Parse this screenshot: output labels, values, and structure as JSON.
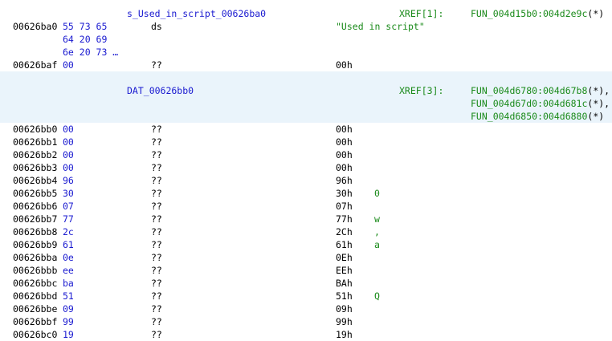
{
  "listing": {
    "string_label": "s_Used_in_script_00626ba0",
    "string_xref_tag": "XREF[1]:",
    "string_xref": {
      "target": "FUN_004d15b0:004d2e9c",
      "marker": "(*)"
    },
    "string_addr": "00626ba0",
    "string_bytes": [
      "55 73 65",
      "64 20 69",
      "6e 20 73 …"
    ],
    "string_mnemonic": "ds",
    "string_value": "\"Used in script\"",
    "term_row": {
      "addr": "00626baf",
      "bytes": "00",
      "mnem": "??",
      "operand": "00h"
    },
    "dat_label": "DAT_00626bb0",
    "dat_xref_tag": "XREF[3]:",
    "dat_xrefs": [
      {
        "target": "FUN_004d6780:004d67b8",
        "marker": "(*),"
      },
      {
        "target": "FUN_004d67d0:004d681c",
        "marker": "(*),"
      },
      {
        "target": "FUN_004d6850:004d6880",
        "marker": "(*)"
      }
    ],
    "rows": [
      {
        "addr": "00626bb0",
        "bytes": "00",
        "mnem": "??",
        "operand": "00h",
        "comment": ""
      },
      {
        "addr": "00626bb1",
        "bytes": "00",
        "mnem": "??",
        "operand": "00h",
        "comment": ""
      },
      {
        "addr": "00626bb2",
        "bytes": "00",
        "mnem": "??",
        "operand": "00h",
        "comment": ""
      },
      {
        "addr": "00626bb3",
        "bytes": "00",
        "mnem": "??",
        "operand": "00h",
        "comment": ""
      },
      {
        "addr": "00626bb4",
        "bytes": "96",
        "mnem": "??",
        "operand": "96h",
        "comment": ""
      },
      {
        "addr": "00626bb5",
        "bytes": "30",
        "mnem": "??",
        "operand": "30h",
        "comment": "0"
      },
      {
        "addr": "00626bb6",
        "bytes": "07",
        "mnem": "??",
        "operand": "07h",
        "comment": ""
      },
      {
        "addr": "00626bb7",
        "bytes": "77",
        "mnem": "??",
        "operand": "77h",
        "comment": "w"
      },
      {
        "addr": "00626bb8",
        "bytes": "2c",
        "mnem": "??",
        "operand": "2Ch",
        "comment": ","
      },
      {
        "addr": "00626bb9",
        "bytes": "61",
        "mnem": "??",
        "operand": "61h",
        "comment": "a"
      },
      {
        "addr": "00626bba",
        "bytes": "0e",
        "mnem": "??",
        "operand": "0Eh",
        "comment": ""
      },
      {
        "addr": "00626bbb",
        "bytes": "ee",
        "mnem": "??",
        "operand": "EEh",
        "comment": ""
      },
      {
        "addr": "00626bbc",
        "bytes": "ba",
        "mnem": "??",
        "operand": "BAh",
        "comment": ""
      },
      {
        "addr": "00626bbd",
        "bytes": "51",
        "mnem": "??",
        "operand": "51h",
        "comment": "Q"
      },
      {
        "addr": "00626bbe",
        "bytes": "09",
        "mnem": "??",
        "operand": "09h",
        "comment": ""
      },
      {
        "addr": "00626bbf",
        "bytes": "99",
        "mnem": "??",
        "operand": "99h",
        "comment": ""
      },
      {
        "addr": "00626bc0",
        "bytes": "19",
        "mnem": "??",
        "operand": "19h",
        "comment": ""
      }
    ]
  },
  "colors": {
    "address": "#000000",
    "bytes": "#1a1ad0",
    "label": "#1a1ad0",
    "xref": "#1a8a1a",
    "highlight_band": "#eaf4fb"
  }
}
